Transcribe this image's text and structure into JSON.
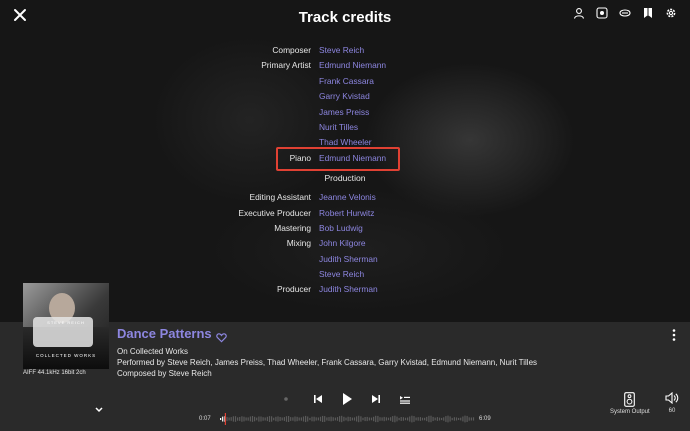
{
  "header": {
    "title": "Track credits"
  },
  "credits": [
    {
      "role": "Composer",
      "name": "Steve Reich"
    },
    {
      "role": "Primary Artist",
      "name": "Edmund Niemann"
    },
    {
      "role": "",
      "name": "Frank Cassara"
    },
    {
      "role": "",
      "name": "Garry Kvistad"
    },
    {
      "role": "",
      "name": "James Preiss"
    },
    {
      "role": "",
      "name": "Nurit Tilles"
    },
    {
      "role": "",
      "name": "Thad Wheeler"
    },
    {
      "role": "Piano",
      "name": "Edmund Niemann"
    }
  ],
  "production": {
    "heading": "Production",
    "credits": [
      {
        "role": "Editing Assistant",
        "name": "Jeanne Velonis"
      },
      {
        "role": "Executive Producer",
        "name": "Robert Hurwitz"
      },
      {
        "role": "Mastering",
        "name": "Bob Ludwig"
      },
      {
        "role": "Mixing",
        "name": "John Kilgore"
      },
      {
        "role": "",
        "name": "Judith Sherman"
      },
      {
        "role": "",
        "name": "Steve Reich"
      },
      {
        "role": "Producer",
        "name": "Judith Sherman"
      }
    ]
  },
  "album_art": {
    "artist_text": "STEVE REICH",
    "title_text": "COLLECTED WORKS"
  },
  "player": {
    "format": "AIFF 44.1kHz 16bit 2ch",
    "track_title": "Dance Patterns",
    "album_line": "On Collected Works",
    "performed_line": "Performed by Steve Reich, James Preiss, Thad Wheeler, Frank Cassara, Garry Kvistad, Edmund Niemann, Nurit Tilles",
    "composed_line": "Composed by Steve Reich",
    "time_elapsed": "0:07",
    "time_total": "6:09",
    "output_label": "System Output",
    "volume": "60",
    "progress": 0.019
  },
  "colors": {
    "accent": "#8d86e0",
    "highlight": "#e04133",
    "player_bg": "#2a2a2a"
  },
  "icons": [
    "close-icon",
    "user-icon",
    "settings-box-icon",
    "roon-icon",
    "bookmark-icon",
    "gear-icon",
    "heart-icon",
    "more-vertical-icon",
    "chevron-down-icon",
    "previous-icon",
    "play-icon",
    "next-icon",
    "queue-icon",
    "speaker-icon",
    "volume-icon"
  ]
}
